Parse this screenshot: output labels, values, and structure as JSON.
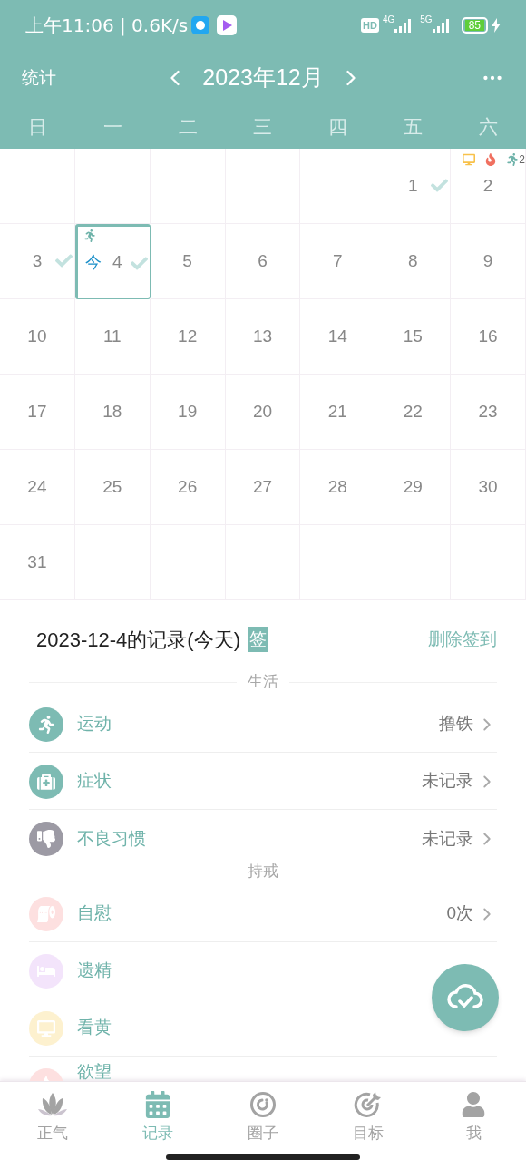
{
  "status_bar": {
    "time": "上午11:06 | 0.6K/s",
    "hd": "HD",
    "net1": "4G",
    "net2": "5G",
    "battery": "85"
  },
  "header": {
    "left": "统计",
    "month": "2023年12月"
  },
  "weekdays": [
    "日",
    "一",
    "二",
    "三",
    "四",
    "五",
    "六"
  ],
  "calendar": [
    [
      {
        "kind": "blank"
      },
      {
        "kind": "blank"
      },
      {
        "kind": "blank"
      },
      {
        "kind": "blank"
      },
      {
        "kind": "blank"
      },
      {
        "kind": "day",
        "day": "1",
        "signed": true,
        "selected": false
      },
      {
        "kind": "day",
        "day": "2",
        "signed": false,
        "selected": false,
        "marks": [
          {
            "kind": "monitor"
          },
          {
            "kind": "fire"
          },
          {
            "kind": "runner"
          }
        ],
        "mark_count": "2"
      }
    ],
    [
      {
        "kind": "day",
        "day": "3",
        "signed": true,
        "selected": false
      },
      {
        "kind": "day",
        "day": "4",
        "signed": true,
        "selected": true,
        "today": "今",
        "marks": [
          {
            "kind": "runner"
          }
        ]
      },
      {
        "kind": "day",
        "day": "5",
        "signed": false,
        "selected": false
      },
      {
        "kind": "day",
        "day": "6",
        "signed": false,
        "selected": false
      },
      {
        "kind": "day",
        "day": "7",
        "signed": false,
        "selected": false
      },
      {
        "kind": "day",
        "day": "8",
        "signed": false,
        "selected": false
      },
      {
        "kind": "day",
        "day": "9",
        "signed": false,
        "selected": false
      }
    ],
    [
      {
        "kind": "day",
        "day": "10",
        "signed": false,
        "selected": false
      },
      {
        "kind": "day",
        "day": "11",
        "signed": false,
        "selected": false
      },
      {
        "kind": "day",
        "day": "12",
        "signed": false,
        "selected": false
      },
      {
        "kind": "day",
        "day": "13",
        "signed": false,
        "selected": false
      },
      {
        "kind": "day",
        "day": "14",
        "signed": false,
        "selected": false
      },
      {
        "kind": "day",
        "day": "15",
        "signed": false,
        "selected": false
      },
      {
        "kind": "day",
        "day": "16",
        "signed": false,
        "selected": false
      }
    ],
    [
      {
        "kind": "day",
        "day": "17",
        "signed": false,
        "selected": false
      },
      {
        "kind": "day",
        "day": "18",
        "signed": false,
        "selected": false
      },
      {
        "kind": "day",
        "day": "19",
        "signed": false,
        "selected": false
      },
      {
        "kind": "day",
        "day": "20",
        "signed": false,
        "selected": false
      },
      {
        "kind": "day",
        "day": "21",
        "signed": false,
        "selected": false
      },
      {
        "kind": "day",
        "day": "22",
        "signed": false,
        "selected": false
      },
      {
        "kind": "day",
        "day": "23",
        "signed": false,
        "selected": false
      }
    ],
    [
      {
        "kind": "day",
        "day": "24",
        "signed": false,
        "selected": false
      },
      {
        "kind": "day",
        "day": "25",
        "signed": false,
        "selected": false
      },
      {
        "kind": "day",
        "day": "26",
        "signed": false,
        "selected": false
      },
      {
        "kind": "day",
        "day": "27",
        "signed": false,
        "selected": false
      },
      {
        "kind": "day",
        "day": "28",
        "signed": false,
        "selected": false
      },
      {
        "kind": "day",
        "day": "29",
        "signed": false,
        "selected": false
      },
      {
        "kind": "day",
        "day": "30",
        "signed": false,
        "selected": false
      }
    ],
    [
      {
        "kind": "day",
        "day": "31",
        "signed": false,
        "selected": false
      },
      {
        "kind": "blank"
      },
      {
        "kind": "blank"
      },
      {
        "kind": "blank"
      },
      {
        "kind": "blank"
      },
      {
        "kind": "blank"
      },
      {
        "kind": "blank"
      }
    ]
  ],
  "record": {
    "title": "2023-12-4的记录(今天)",
    "badge": "签",
    "action": "删除签到",
    "sections": [
      {
        "title": "生活",
        "items": [
          {
            "kind": "runner",
            "color": "#7dbbb3",
            "label": "运动",
            "value": "撸铁"
          },
          {
            "kind": "medkit",
            "color": "#7dbbb3",
            "label": "症状",
            "value": "未记录"
          },
          {
            "kind": "thumbs-down",
            "color": "#9c9aa4",
            "label": "不良习惯",
            "value": "未记录"
          }
        ]
      },
      {
        "title": "持戒",
        "items": [
          {
            "kind": "toilet-paper",
            "color": "#fde0e0",
            "label": "自慰",
            "value": "0次"
          },
          {
            "kind": "bed",
            "color": "#f3e4fb",
            "label": "遗精"
          },
          {
            "kind": "monitor",
            "color": "#fdf1cf",
            "label": "看黄"
          },
          {
            "kind": "fire",
            "color": "#fde0e0",
            "label": "欲望"
          }
        ]
      }
    ]
  },
  "bottom_nav": [
    {
      "kind": "lotus",
      "label": "正气",
      "selected": false
    },
    {
      "kind": "calendar",
      "label": "记录",
      "selected": true
    },
    {
      "kind": "circle",
      "label": "圈子",
      "selected": false
    },
    {
      "kind": "target",
      "label": "目标",
      "selected": false
    },
    {
      "kind": "user",
      "label": "我",
      "selected": false
    }
  ]
}
